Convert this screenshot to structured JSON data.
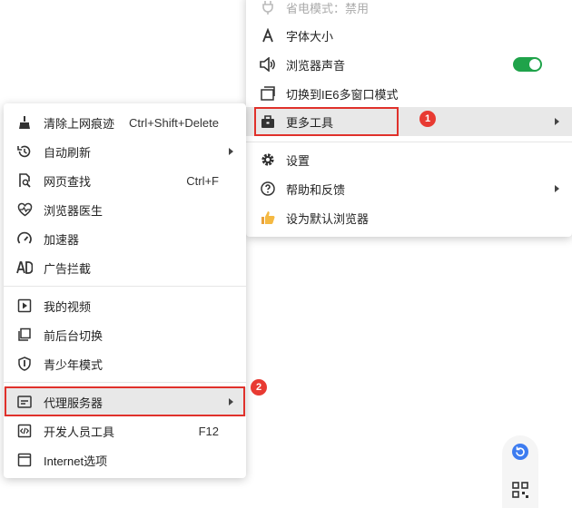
{
  "main_menu": {
    "items": [
      {
        "label": "省电模式：禁用",
        "icon": "power-plug-icon"
      },
      {
        "label": "字体大小",
        "icon": "font-icon"
      },
      {
        "label": "浏览器声音",
        "icon": "speaker-icon",
        "toggle_on": true
      },
      {
        "label": "切换到IE6多窗口模式",
        "icon": "windows-icon"
      },
      {
        "label": "更多工具",
        "icon": "toolbox-icon",
        "has_submenu": true
      },
      {
        "label": "设置",
        "icon": "gear-icon"
      },
      {
        "label": "帮助和反馈",
        "icon": "help-icon",
        "has_submenu": true
      },
      {
        "label": "设为默认浏览器",
        "icon": "thumbs-up-icon"
      }
    ]
  },
  "sub_menu": {
    "items": [
      {
        "label": "清除上网痕迹",
        "shortcut": "Ctrl+Shift+Delete",
        "icon": "broom-icon"
      },
      {
        "label": "自动刷新",
        "icon": "refresh-clock-icon",
        "has_submenu": true
      },
      {
        "label": "网页查找",
        "shortcut": "Ctrl+F",
        "icon": "find-icon"
      },
      {
        "label": "浏览器医生",
        "icon": "heart-pulse-icon"
      },
      {
        "label": "加速器",
        "icon": "speedometer-icon"
      },
      {
        "label": "广告拦截",
        "icon": "ad-block-icon"
      },
      {
        "label": "我的视频",
        "icon": "play-icon"
      },
      {
        "label": "前后台切换",
        "icon": "switch-icon"
      },
      {
        "label": "青少年模式",
        "icon": "shield-icon"
      },
      {
        "label": "代理服务器",
        "icon": "proxy-icon",
        "has_submenu": true
      },
      {
        "label": "开发人员工具",
        "shortcut": "F12",
        "icon": "code-icon"
      },
      {
        "label": "Internet选项",
        "icon": "ie-options-icon"
      }
    ]
  },
  "annotations": {
    "step1": "1",
    "step2": "2"
  },
  "colors": {
    "highlight": "#e8e8e8",
    "annotation_red": "#e0312b",
    "toggle_on": "#1fa34a"
  }
}
